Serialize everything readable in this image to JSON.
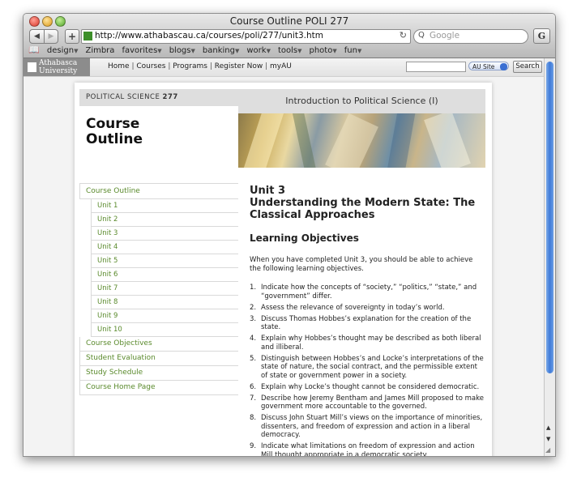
{
  "window": {
    "title": "Course Outline POLI 277"
  },
  "toolbar": {
    "back": "◀",
    "forward": "▶",
    "add": "+",
    "url": "http://www.athabascau.ca/courses/poli/277/unit3.htm",
    "reload": "↻",
    "search_placeholder": "Google",
    "search_icon": "Q",
    "google_button": "G"
  },
  "bookmarks": [
    {
      "label": "design",
      "menu": true
    },
    {
      "label": "Zimbra",
      "menu": false
    },
    {
      "label": "favorites",
      "menu": true
    },
    {
      "label": "blogs",
      "menu": true
    },
    {
      "label": "banking",
      "menu": true
    },
    {
      "label": "work",
      "menu": true
    },
    {
      "label": "tools",
      "menu": true
    },
    {
      "label": "photo",
      "menu": true
    },
    {
      "label": "fun",
      "menu": true
    }
  ],
  "site": {
    "logo_line1": "Athabasca",
    "logo_line2": "University",
    "nav": [
      "Home",
      "Courses",
      "Programs",
      "Register Now",
      "myAU"
    ],
    "search_scope": "AU Site",
    "search_button": "Search"
  },
  "course": {
    "code_prefix": "POLITICAL SCIENCE",
    "code_number": "277",
    "name": "Introduction to Political Science (I)",
    "outline_line1": "Course",
    "outline_line2": "Outline"
  },
  "sidenav": {
    "outline": "Course Outline",
    "units": [
      "Unit 1",
      "Unit 2",
      "Unit 3",
      "Unit 4",
      "Unit 5",
      "Unit 6",
      "Unit 7",
      "Unit 8",
      "Unit 9",
      "Unit 10"
    ],
    "bottom": [
      "Course Objectives",
      "Student Evaluation",
      "Study Schedule",
      "Course Home Page"
    ]
  },
  "unit": {
    "number": "Unit 3",
    "title": "Understanding the Modern State: The Classical Approaches",
    "lo_heading": "Learning Objectives",
    "intro": "When you have completed Unit 3, you should be able to achieve the following learning objectives.",
    "objectives": [
      {
        "num": "1.",
        "text": "Indicate how the concepts of “society,” “politics,” “state,” and “government” differ."
      },
      {
        "num": "2.",
        "text": "Assess the relevance of sovereignty in today’s world."
      },
      {
        "num": "3.",
        "text": "Discuss Thomas Hobbes’s explanation for the creation of the state."
      },
      {
        "num": "4.",
        "text": "Explain why Hobbes’s thought may be described as both liberal and illiberal."
      },
      {
        "num": "5.",
        "text": "Distinguish between Hobbes’s and Locke’s interpretations of the state of nature, the social contract, and the permissible extent of state or government power in a society."
      },
      {
        "num": "6.",
        "text": "Explain why Locke’s thought cannot be considered democratic."
      },
      {
        "num": "7.",
        "text": "Describe how Jeremy Bentham and James Mill proposed to make government more accountable to the governed."
      },
      {
        "num": "8.",
        "text": "Discuss John Stuart Mill’s views on the importance of minorities, dissenters, and freedom of expression and action in a liberal democracy."
      },
      {
        "num": "9.",
        "text": "Indicate what limitations on freedom of expression and action Mill thought appropriate in a democratic society."
      }
    ]
  },
  "colors": {
    "link_green": "#5a8a2c",
    "scroll_blue": "#3f7ad8",
    "header_gray": "#dedede"
  }
}
